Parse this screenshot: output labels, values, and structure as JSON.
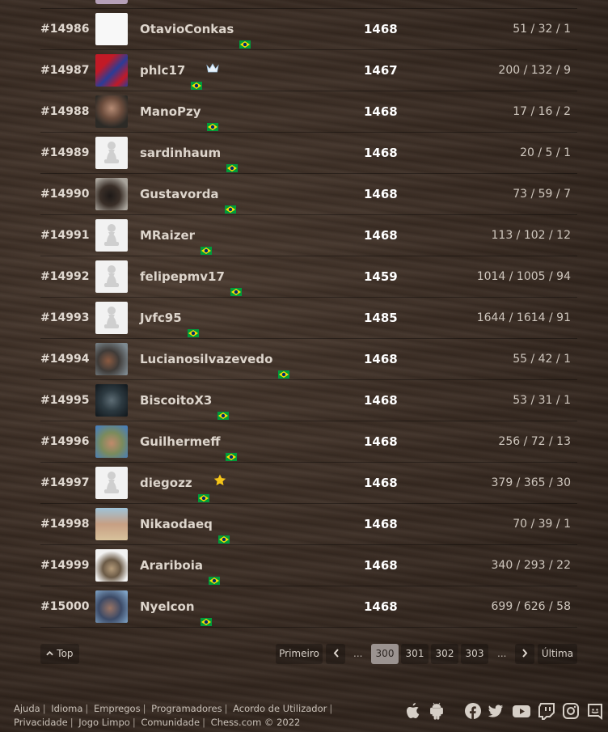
{
  "rows": [
    {
      "rank": "#14986",
      "username": "OtavioConkas",
      "rating": "1468",
      "stats": "51 / 32 / 1",
      "avatar": "blank-white",
      "badge": ""
    },
    {
      "rank": "#14987",
      "username": "phlc17",
      "rating": "1467",
      "stats": "200 / 132 / 9",
      "avatar": "red-blue-logo",
      "badge": "crown"
    },
    {
      "rank": "#14988",
      "username": "ManoPzy",
      "rating": "1468",
      "stats": "17 / 16 / 2",
      "avatar": "photo-man",
      "badge": ""
    },
    {
      "rank": "#14989",
      "username": "sardinhaum",
      "rating": "1468",
      "stats": "20 / 5 / 1",
      "avatar": "pawn",
      "badge": ""
    },
    {
      "rank": "#14990",
      "username": "Gustavorda",
      "rating": "1468",
      "stats": "73 / 59 / 7",
      "avatar": "photo-dog",
      "badge": ""
    },
    {
      "rank": "#14991",
      "username": "MRaizer",
      "rating": "1468",
      "stats": "113 / 102 / 12",
      "avatar": "pawn",
      "badge": ""
    },
    {
      "rank": "#14992",
      "username": "felipepmv17",
      "rating": "1459",
      "stats": "1014 / 1005 / 94",
      "avatar": "pawn",
      "badge": ""
    },
    {
      "rank": "#14993",
      "username": "Jvfc95",
      "rating": "1485",
      "stats": "1644 / 1614 / 91",
      "avatar": "pawn",
      "badge": ""
    },
    {
      "rank": "#14994",
      "username": "Lucianosilvazevedo",
      "rating": "1468",
      "stats": "55 / 42 / 1",
      "avatar": "photo-selfie",
      "badge": ""
    },
    {
      "rank": "#14995",
      "username": "BiscoitoX3",
      "rating": "1468",
      "stats": "53 / 31 / 1",
      "avatar": "photo-dark-art",
      "badge": ""
    },
    {
      "rank": "#14996",
      "username": "Guilhermeff",
      "rating": "1468",
      "stats": "256 / 72 / 13",
      "avatar": "photo-smile",
      "badge": ""
    },
    {
      "rank": "#14997",
      "username": "diegozz",
      "rating": "1468",
      "stats": "379 / 365 / 30",
      "avatar": "pawn",
      "badge": "star"
    },
    {
      "rank": "#14998",
      "username": "Nikaodaeq",
      "rating": "1468",
      "stats": "70 / 39 / 1",
      "avatar": "photo-beach",
      "badge": ""
    },
    {
      "rank": "#14999",
      "username": "Arariboia",
      "rating": "1468",
      "stats": "340 / 293 / 22",
      "avatar": "walrus-hat",
      "badge": ""
    },
    {
      "rank": "#15000",
      "username": "Nyelcon",
      "rating": "1468",
      "stats": "699 / 626 / 58",
      "avatar": "photo-cap",
      "badge": ""
    }
  ],
  "top_button": "Top",
  "pagination": {
    "first": "Primeiro",
    "prev_icon": "chevron-left-icon",
    "dots_before": "...",
    "pages": [
      "300",
      "301",
      "302",
      "303"
    ],
    "active": "300",
    "dots_after": "...",
    "next_icon": "chevron-right-icon",
    "last": "Última"
  },
  "footer": {
    "line1": [
      "Ajuda",
      "Idioma",
      "Empregos",
      "Programadores",
      "Acordo de Utilizador"
    ],
    "line2": [
      "Privacidade",
      "Jogo Limpo",
      "Comunidade",
      "Chess.com © 2022"
    ]
  },
  "social_icons": [
    "apple-icon",
    "android-icon",
    "facebook-icon",
    "twitter-icon",
    "youtube-icon",
    "twitch-icon",
    "instagram-icon",
    "discord-icon"
  ],
  "colors": {
    "active_page": "#9b9390",
    "flag_green": "#009c3b",
    "flag_yellow": "#ffdf00",
    "flag_blue": "#002776"
  }
}
